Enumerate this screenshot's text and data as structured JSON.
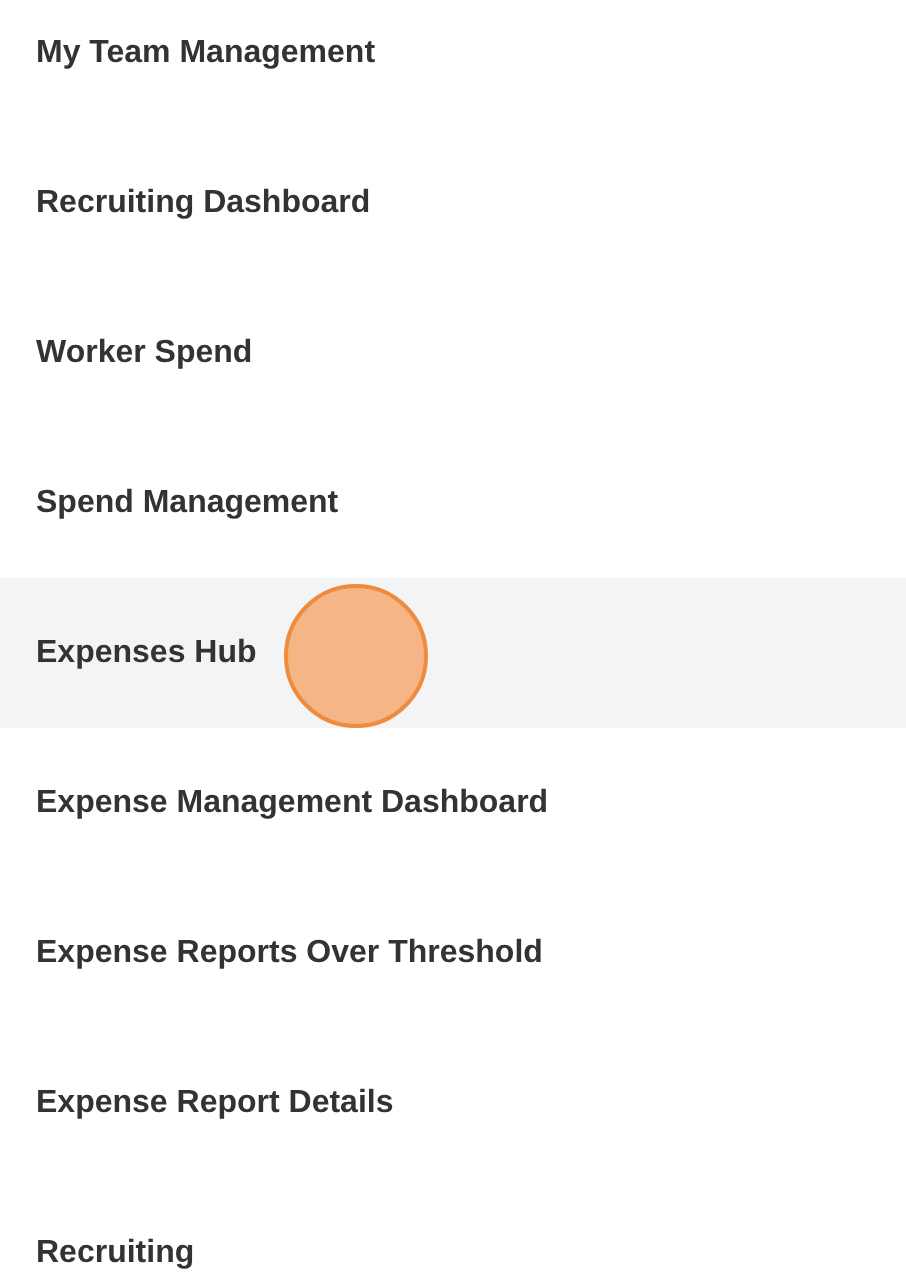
{
  "menu_items": [
    {
      "label": "My Team Management",
      "selected": false
    },
    {
      "label": "Recruiting Dashboard",
      "selected": false
    },
    {
      "label": "Worker Spend",
      "selected": false
    },
    {
      "label": "Spend Management",
      "selected": false
    },
    {
      "label": "Expenses Hub",
      "selected": true
    },
    {
      "label": "Expense Management Dashboard",
      "selected": false
    },
    {
      "label": "Expense Reports Over Threshold",
      "selected": false
    },
    {
      "label": "Expense Report Details",
      "selected": false
    },
    {
      "label": "Recruiting",
      "selected": false
    }
  ]
}
